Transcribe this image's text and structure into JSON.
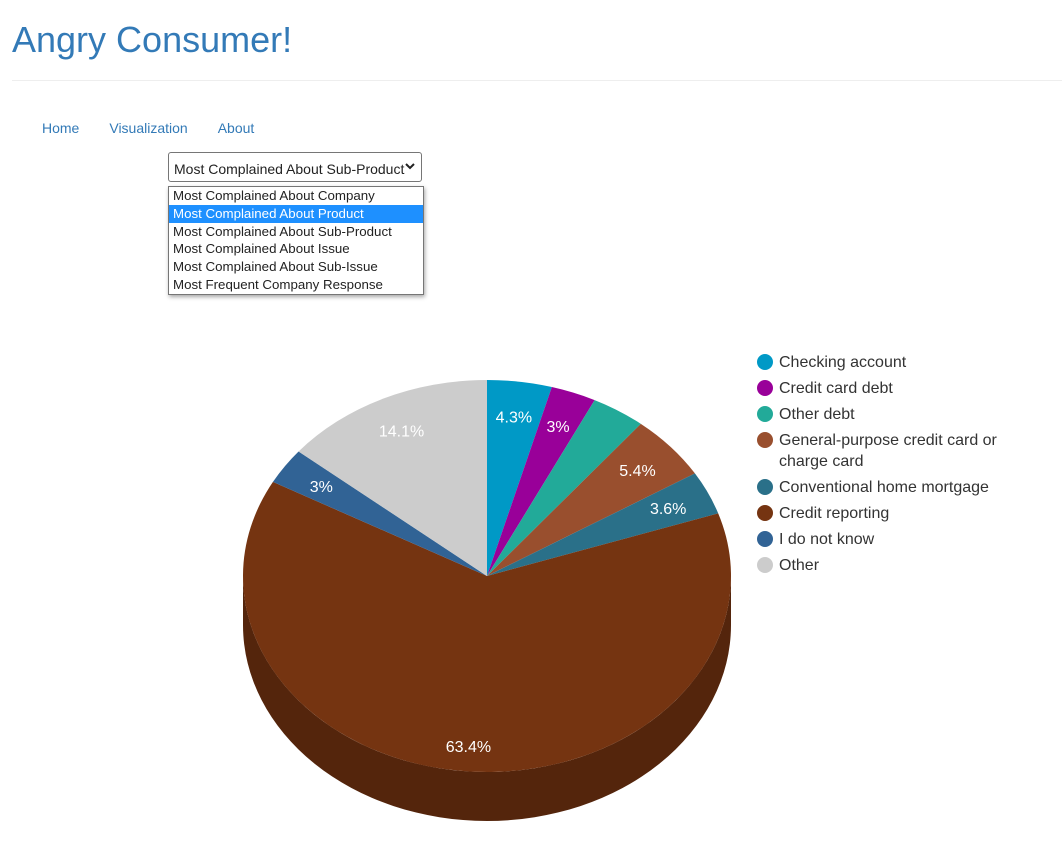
{
  "header": {
    "title": "Angry Consumer!"
  },
  "nav": {
    "items": [
      "Home",
      "Visualization",
      "About"
    ]
  },
  "select": {
    "value": "Most Complained About Sub-Product",
    "highlighted_index": 1,
    "options": [
      "Most Complained About Company",
      "Most Complained About Product",
      "Most Complained About Sub-Product",
      "Most Complained About Issue",
      "Most Complained About Sub-Issue",
      "Most Frequent Company Response"
    ]
  },
  "chart_data": {
    "type": "pie",
    "style": "3d",
    "legend_position": "right",
    "slices": [
      {
        "label": "Checking account",
        "value": 4.3,
        "value_label": "4.3%",
        "color": "#0099c6"
      },
      {
        "label": "Credit card debt",
        "value": 3.0,
        "value_label": "3%",
        "color": "#990099"
      },
      {
        "label": "Other debt",
        "value": 3.6,
        "value_label": "",
        "color": "#22aa99"
      },
      {
        "label": "General-purpose credit card or charge card",
        "value": 5.4,
        "value_label": "5.4%",
        "color": "#994f2e"
      },
      {
        "label": "Conventional home mortgage",
        "value": 3.6,
        "value_label": "3.6%",
        "color": "#2a7089"
      },
      {
        "label": "Credit reporting",
        "value": 63.4,
        "value_label": "63.4%",
        "color": "#753411"
      },
      {
        "label": "I do not know",
        "value": 3.0,
        "value_label": "3%",
        "color": "#316395"
      },
      {
        "label": "Other",
        "value": 14.1,
        "value_label": "14.1%",
        "color": "#cccccc"
      }
    ]
  }
}
